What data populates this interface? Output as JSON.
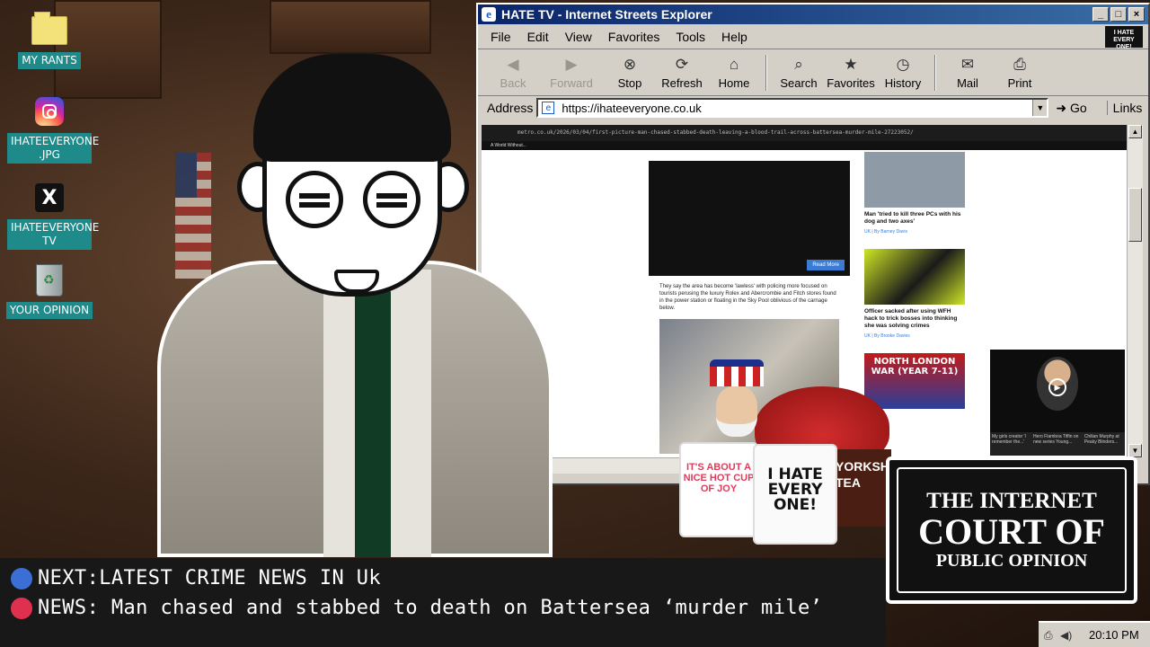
{
  "desktop": {
    "icons": [
      {
        "label": "MY RANTS",
        "icon": "folder-icon"
      },
      {
        "label": "IHATEEVERYONE .JPG",
        "icon": "instagram-icon"
      },
      {
        "label": "IHATEEVERYONE TV",
        "icon": "x-icon"
      },
      {
        "label": "YOUR OPINION",
        "icon": "recycle-bin-icon"
      }
    ]
  },
  "browser": {
    "title": "HATE TV - Internet Streets Explorer",
    "menu": [
      "File",
      "Edit",
      "View",
      "Favorites",
      "Tools",
      "Help"
    ],
    "brand_badge": "I HATE EVERY ONE!",
    "toolbar": [
      {
        "label": "Back",
        "icon": "back-arrow-icon",
        "disabled": true
      },
      {
        "label": "Forward",
        "icon": "forward-arrow-icon",
        "disabled": true
      },
      {
        "label": "Stop",
        "icon": "stop-icon"
      },
      {
        "label": "Refresh",
        "icon": "refresh-icon"
      },
      {
        "label": "Home",
        "icon": "home-icon"
      },
      {
        "label": "Search",
        "icon": "search-icon"
      },
      {
        "label": "Favorites",
        "icon": "favorites-icon"
      },
      {
        "label": "History",
        "icon": "history-icon"
      },
      {
        "label": "Mail",
        "icon": "mail-icon"
      },
      {
        "label": "Print",
        "icon": "print-icon"
      }
    ],
    "address_label": "Address",
    "address_value": "https://ihateeveryone.co.uk",
    "go_label": "Go",
    "links_label": "Links",
    "page": {
      "inner_url": "metro.co.uk/2026/03/04/first-picture-man-chased-stabbed-death-leaving-a-blood-trail-across-battersea-murder-mile-27223052/",
      "inner_tab": "A World Without...",
      "ad_button": "Read More",
      "article_text": "They say the area has become 'lawless' with policing more focused on tourists perusing the luxury Rolex and Abercrombie and Fitch stores found in the power station or floating in the Sky Pool oblivious of the carnage below.",
      "sidebar": [
        {
          "caption": "Man 'tried to kill three PCs with his dog and two axes'",
          "byline": "UK | By Barney Davis"
        },
        {
          "caption": "Officer sacked after using WFH hack to trick bosses into thinking she was solving crimes",
          "byline": "UK | By Brooke Davies"
        },
        {
          "caption": "NORTH LONDON WAR (YEAR 7-11)",
          "byline": ""
        }
      ],
      "video_strip": [
        "My girls creator 'I remember the...'",
        "Hero Flamboa Tiffin on new series Young...",
        "Chilian Murphy at Peaky Blinders..."
      ]
    }
  },
  "merch": {
    "mug_left": "IT'S ABOUT A NICE HOT CUP OF JOY",
    "mug_right": "I HATE EVERY ONE!",
    "tea_box": "YORKSHIRE TEA"
  },
  "court_sign": {
    "line1": "THE INTERNET",
    "line2": "COURT OF",
    "line3": "PUBLIC OPINION"
  },
  "ticker": {
    "next": "NEXT:LATEST CRIME NEWS IN Uk",
    "news": "NEWS: Man chased and stabbed to death on Battersea ‘murder mile’",
    "next_color": "#3b6fd6",
    "news_color": "#e0304f"
  },
  "taskbar": {
    "clock": "20:10 PM"
  }
}
